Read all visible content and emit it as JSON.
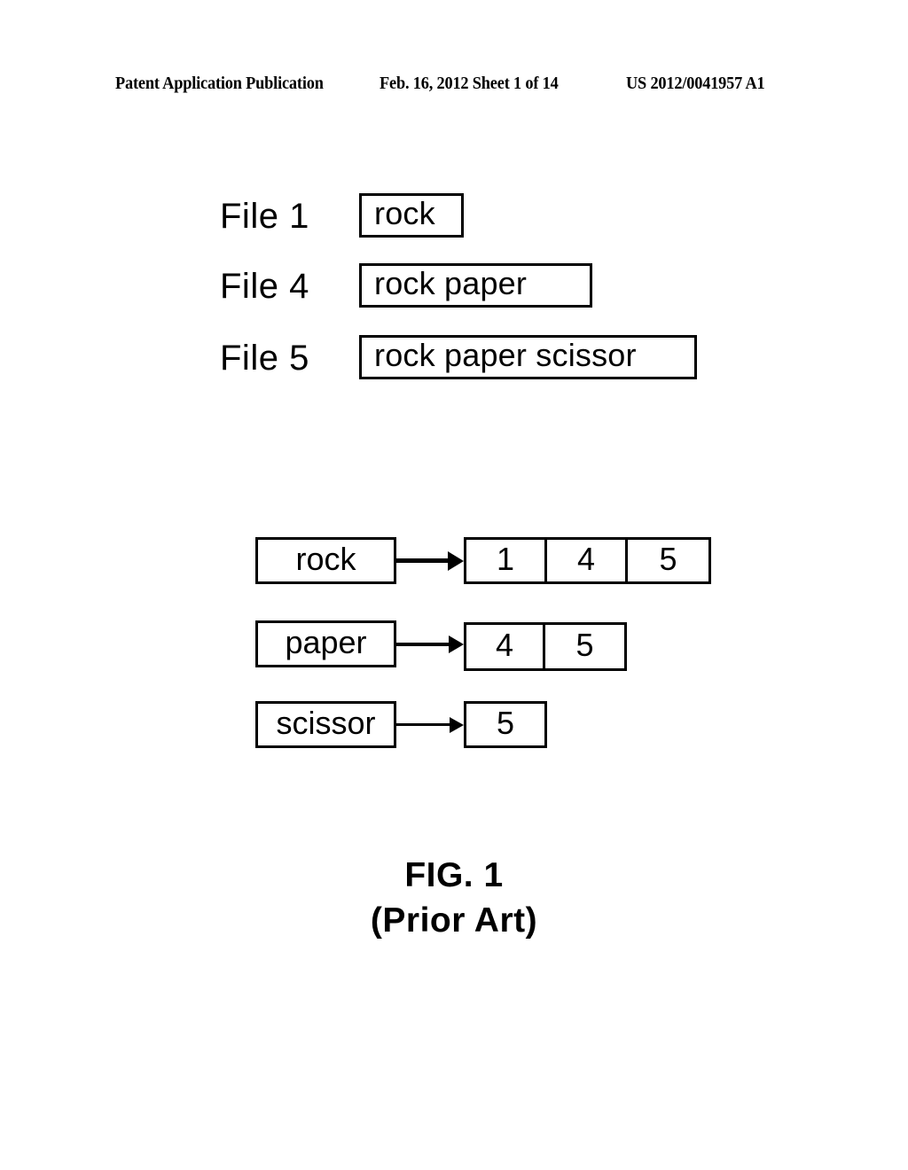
{
  "header": {
    "publication": "Patent Application Publication",
    "date_sheet": "Feb. 16, 2012  Sheet 1 of 14",
    "patent_number": "US 2012/0041957 A1"
  },
  "figure": {
    "documents": [
      {
        "label": "File 1",
        "content": "rock"
      },
      {
        "label": "File 4",
        "content": "rock paper"
      },
      {
        "label": "File 5",
        "content": "rock paper scissor"
      }
    ],
    "inverted_index": [
      {
        "term": "rock",
        "postings": [
          "1",
          "4",
          "5"
        ]
      },
      {
        "term": "paper",
        "postings": [
          "4",
          "5"
        ]
      },
      {
        "term": "scissor",
        "postings": [
          "5"
        ]
      }
    ],
    "caption": {
      "title": "FIG. 1",
      "subtitle": "(Prior Art)"
    }
  },
  "colors": {
    "ink": "#000000",
    "paper": "#ffffff"
  }
}
